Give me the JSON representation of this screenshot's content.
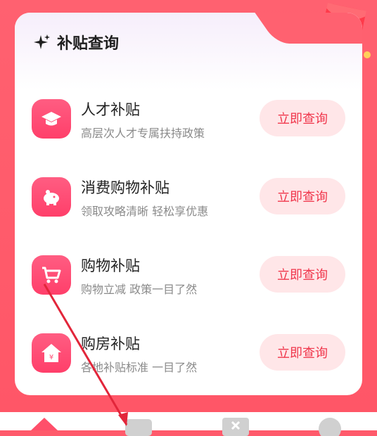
{
  "section": {
    "title": "补贴查询",
    "icon": "sparkle-icon"
  },
  "items": [
    {
      "title": "人才补贴",
      "subtitle": "高层次人才专属扶持政策",
      "button": "立即查询",
      "icon": "graduation-cap-icon"
    },
    {
      "title": "消费购物补贴",
      "subtitle": "领取攻略清晰 轻松享优惠",
      "button": "立即查询",
      "icon": "piggy-bank-icon"
    },
    {
      "title": "购物补贴",
      "subtitle": "购物立减 政策一目了然",
      "button": "立即查询",
      "icon": "shopping-cart-icon"
    },
    {
      "title": "购房补贴",
      "subtitle": "各地补贴标准 一目了然",
      "button": "立即查询",
      "icon": "house-yuan-icon"
    }
  ],
  "colors": {
    "background": "#ff5a6b",
    "accent": "#f0374c",
    "button_bg": "#ffe6e8",
    "icon_bg": "#ff4f76"
  },
  "bottom_tabs": [
    "home-icon",
    "wallet-icon",
    "ticket-icon",
    "profile-icon"
  ]
}
